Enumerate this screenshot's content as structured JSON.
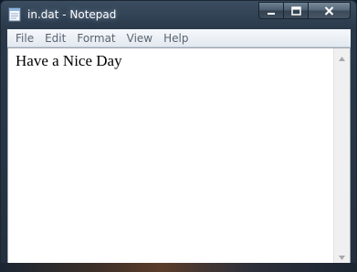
{
  "window": {
    "title": "in.dat - Notepad",
    "icon": "notepad-icon"
  },
  "caption_buttons": {
    "minimize_icon": "minimize-icon",
    "maximize_icon": "maximize-icon",
    "close_icon": "close-icon"
  },
  "menu": {
    "items": [
      {
        "label": "File"
      },
      {
        "label": "Edit"
      },
      {
        "label": "Format"
      },
      {
        "label": "View"
      },
      {
        "label": "Help"
      }
    ]
  },
  "document": {
    "content": "Have a Nice Day"
  },
  "colors": {
    "frame": "#2a3a4b",
    "menubar": "#e8eef5",
    "editor_bg": "#ffffff"
  }
}
